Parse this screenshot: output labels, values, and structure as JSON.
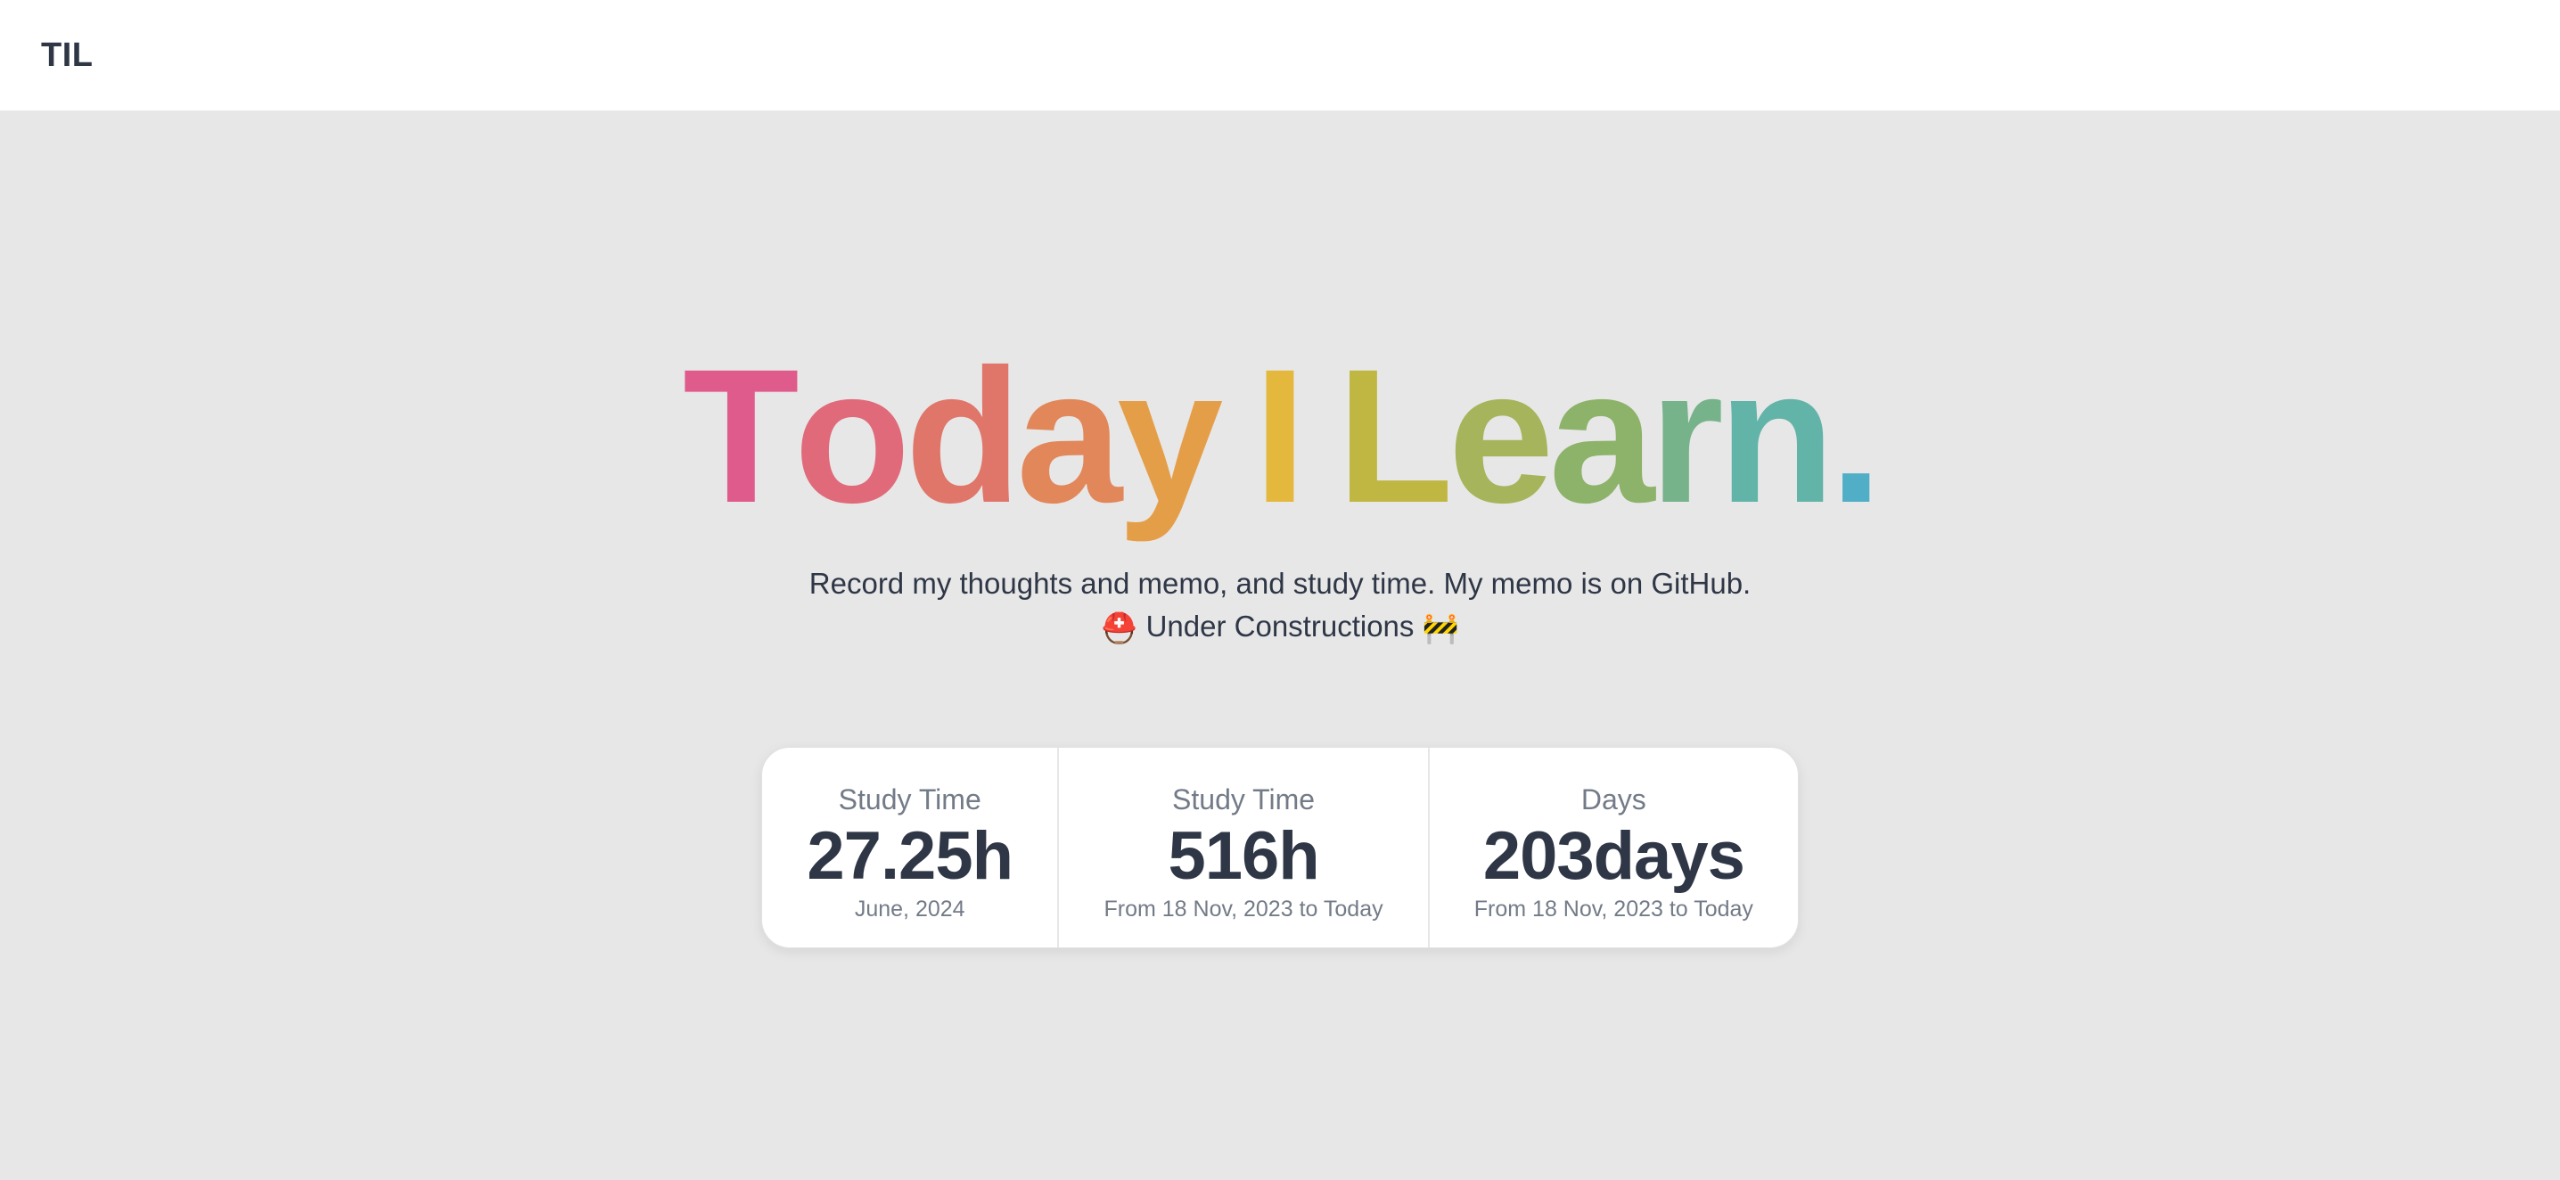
{
  "navbar": {
    "brand": "TIL"
  },
  "hero": {
    "title_letters": [
      "T",
      "o",
      "d",
      "a",
      "y",
      " ",
      "I",
      " ",
      "L",
      "e",
      "a",
      "r",
      "n",
      "."
    ],
    "title_colors": [
      "#df5b8c",
      "#e06a7a",
      "#e0766a",
      "#e2875a",
      "#e59e48",
      "#ffffff",
      "#e3b83c",
      "#ffffff",
      "#c0b642",
      "#a6b55b",
      "#8db36a",
      "#76b28a",
      "#62b4a8",
      "#50aec6"
    ],
    "subtitle": "Record my thoughts and memo, and study time. My memo is on GitHub.",
    "status_emoji_left": "⛑️",
    "status_text": "Under Constructions",
    "status_emoji_right": "🚧"
  },
  "stats": [
    {
      "title": "Study Time",
      "value": "27.25h",
      "desc": "June, 2024"
    },
    {
      "title": "Study Time",
      "value": "516h",
      "desc": "From 18 Nov, 2023 to Today"
    },
    {
      "title": "Days",
      "value": "203days",
      "desc": "From 18 Nov, 2023 to Today"
    }
  ]
}
